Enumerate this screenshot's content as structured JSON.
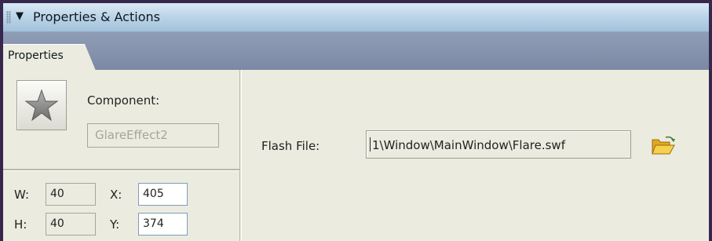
{
  "panel": {
    "title": "Properties & Actions",
    "collapse_icon": "triangle-down-icon",
    "grip_icon": "drag-grip-icon"
  },
  "tabs": [
    {
      "label": "Properties",
      "active": true
    }
  ],
  "component": {
    "icon": "star-icon",
    "label": "Component:",
    "name": "GlareEffect2"
  },
  "dimensions": {
    "w_label": "W:",
    "w_value": "40",
    "h_label": "H:",
    "h_value": "40",
    "x_label": "X:",
    "x_value": "405",
    "y_label": "Y:",
    "y_value": "374"
  },
  "flash": {
    "label": "Flash File:",
    "value": "1\\Window\\MainWindow\\Flare.swf",
    "browse_icon": "open-folder-icon"
  },
  "colors": {
    "background": "#36284d",
    "panel": "#ecebe0",
    "titlebar": "#b7d1e6",
    "tabstrip": "#8593ad",
    "folder": "#f0c030"
  }
}
